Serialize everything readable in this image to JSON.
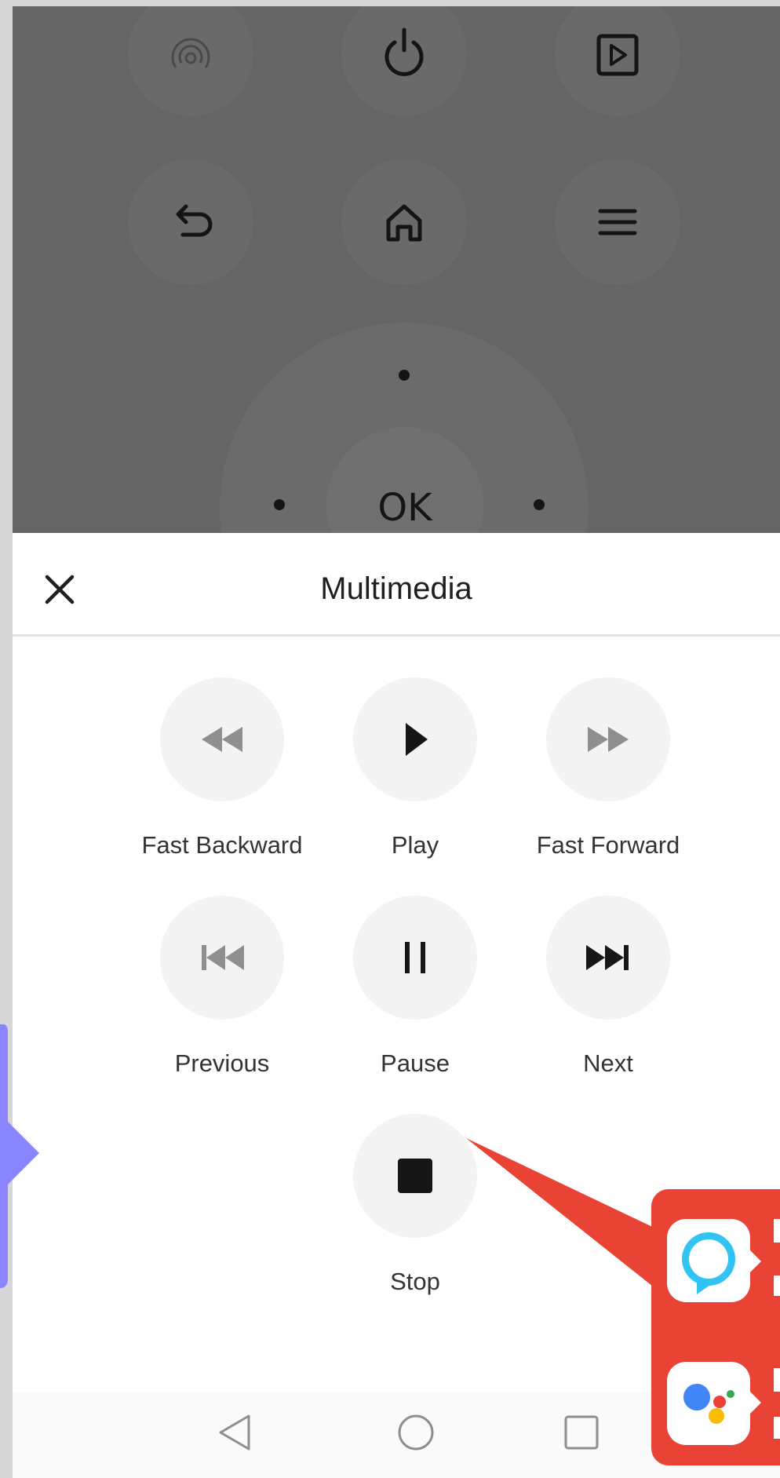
{
  "remote": {
    "ok_label": "OK",
    "top_row": [
      "signal-icon",
      "power-icon",
      "input-play-icon"
    ],
    "second_row": [
      "back-icon",
      "home-icon",
      "menu-icon"
    ]
  },
  "sheet": {
    "title": "Multimedia",
    "buttons": [
      {
        "label": "Fast Backward",
        "icon": "fast-backward-icon"
      },
      {
        "label": "Play",
        "icon": "play-icon"
      },
      {
        "label": "Fast Forward",
        "icon": "fast-forward-icon"
      },
      {
        "label": "Previous",
        "icon": "previous-icon"
      },
      {
        "label": "Pause",
        "icon": "pause-icon"
      },
      {
        "label": "Next",
        "icon": "next-icon"
      },
      {
        "label": "Stop",
        "icon": "stop-icon"
      }
    ]
  },
  "navbar": [
    "nav-back-icon",
    "nav-home-icon",
    "nav-recents-icon"
  ],
  "colors": {
    "dim_overlay": "#656565",
    "button_bg": "#f3f3f3",
    "promo_red": "#e84335",
    "side_arrow": "#8a85ff",
    "alexa_blue": "#31c4f3",
    "assistant_blue": "#4285f4",
    "assistant_red": "#ea4335",
    "assistant_yellow": "#fbbc05",
    "assistant_green": "#34a853"
  }
}
